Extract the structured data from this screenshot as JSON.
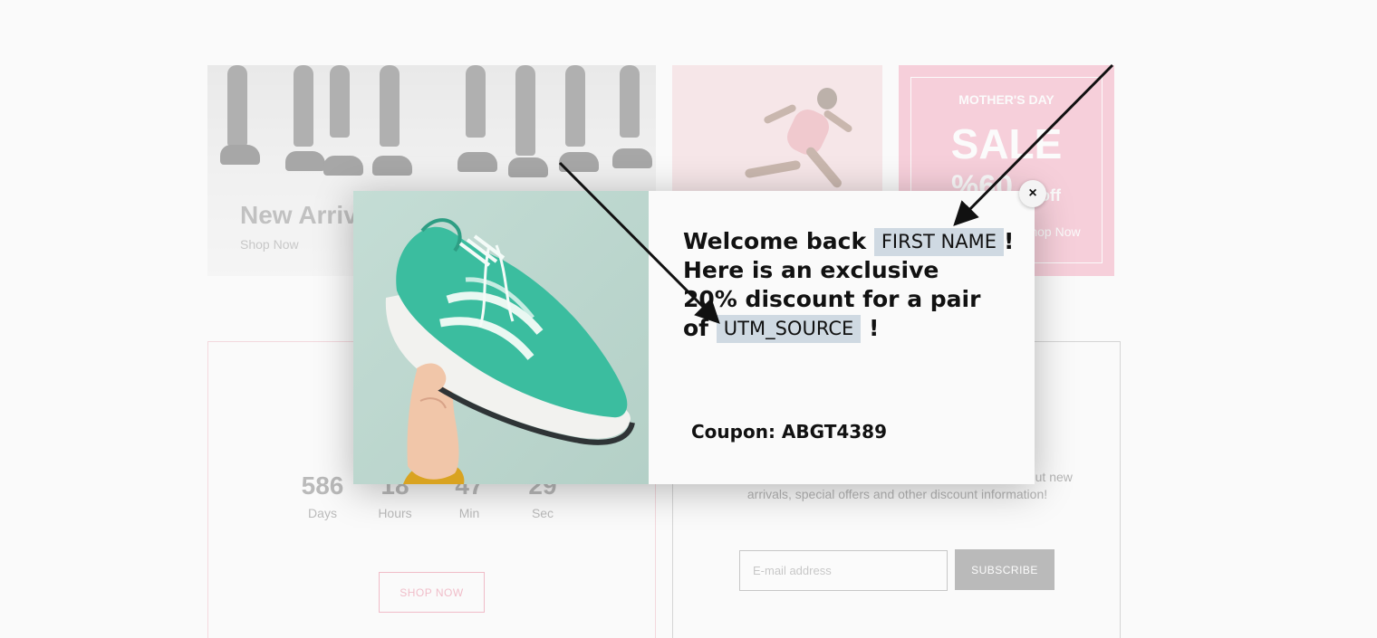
{
  "background": {
    "arrivals_banner": {
      "title": "New Arrivals",
      "link": "Shop Now"
    },
    "sale_banner": {
      "subtitle": "MOTHER'S DAY",
      "title": "SALE",
      "percent": "%60",
      "off": "off",
      "link": "Shop Now"
    },
    "countdown": [
      {
        "value": "586",
        "label": "Days"
      },
      {
        "value": "18",
        "label": "Hours"
      },
      {
        "value": "47",
        "label": "Min"
      },
      {
        "value": "29",
        "label": "Sec"
      }
    ],
    "shop_now_button": "SHOP NOW",
    "newsletter": {
      "text": "Subscribe to our newsletter and be the first to know about new arrivals, special offers and other discount information!",
      "email_placeholder": "E-mail address",
      "subscribe_button": "SUBSCRIBE"
    }
  },
  "modal": {
    "headline_line1_prefix": "Welcome back",
    "first_name_tag": "FIRST NAME",
    "exclaim": "!",
    "headline_line2": "Here is an exclusive",
    "headline_line3": "20% discount for a pair",
    "headline_line4_prefix": "of",
    "utm_source_tag": "UTM_SOURCE",
    "coupon_label": "Coupon:",
    "coupon_code": "ABGT4389",
    "close_label": "×"
  },
  "colors": {
    "tag_background": "#cfd9e2",
    "sale_pink": "#f08aa9",
    "accent_pink": "#e05a78"
  }
}
